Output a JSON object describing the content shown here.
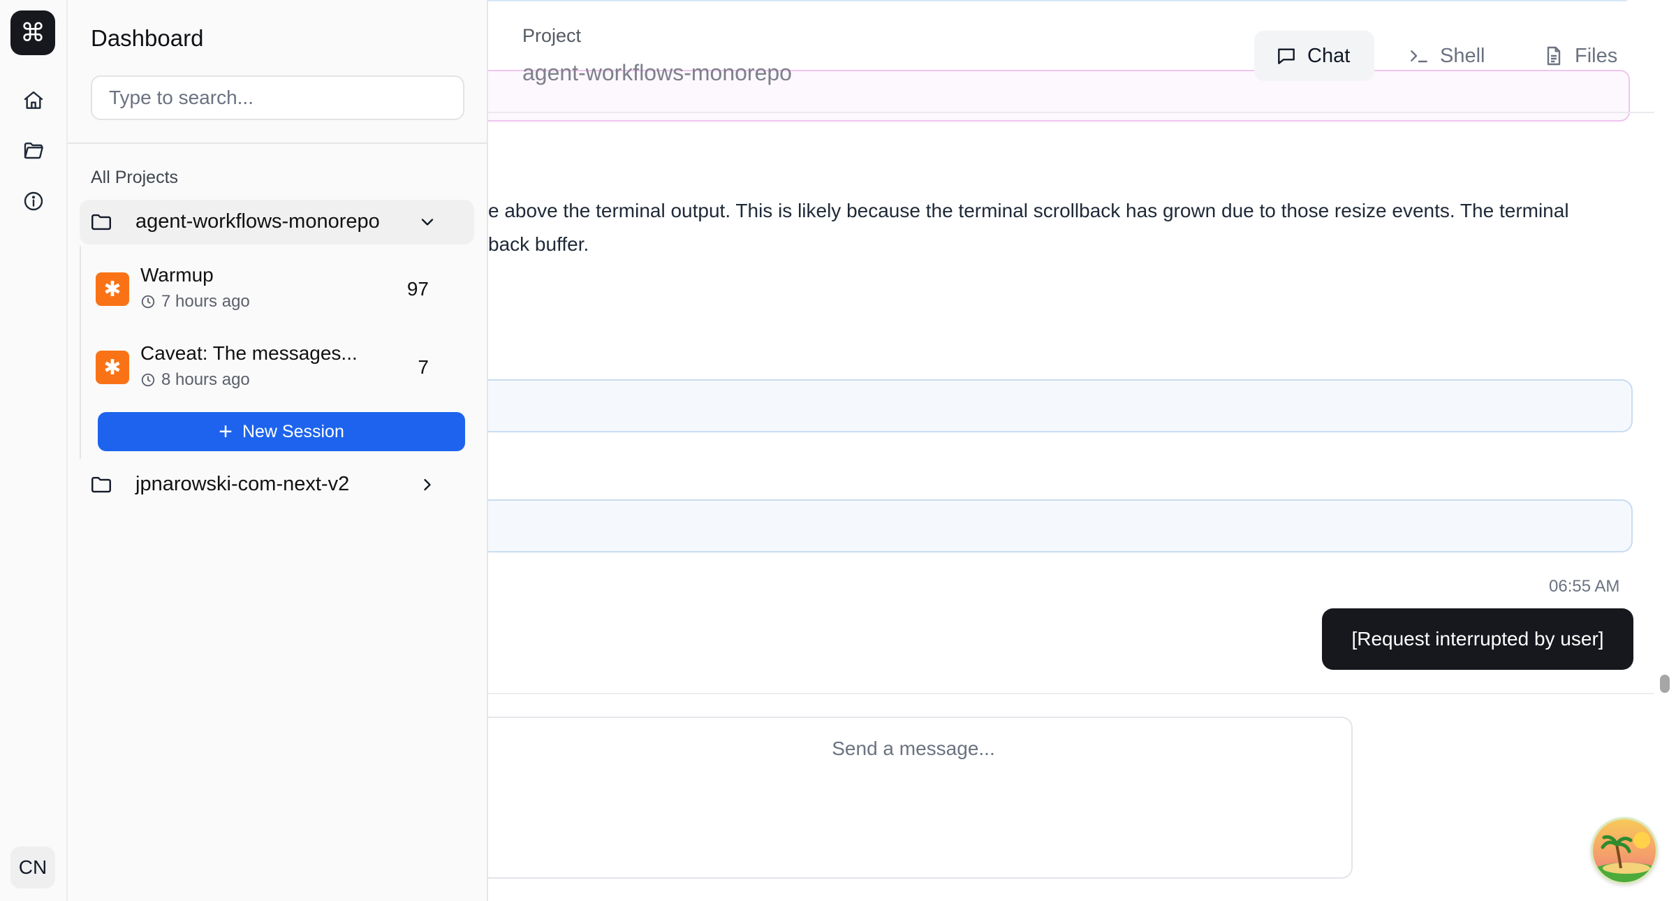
{
  "rail": {
    "logo_glyph": "⌘",
    "user_initials": "CN"
  },
  "sidebar": {
    "title": "Dashboard",
    "search_placeholder": "Type to search...",
    "section_label": "All Projects",
    "projects": [
      {
        "name": "agent-workflows-monorepo",
        "expanded": true,
        "sessions": [
          {
            "title": "Warmup",
            "time": "7 hours ago",
            "count": "97"
          },
          {
            "title": "Caveat: The messages...",
            "time": "8 hours ago",
            "count": "7"
          }
        ],
        "new_session_label": "New Session"
      },
      {
        "name": "jpnarowski-com-next-v2",
        "expanded": false
      }
    ]
  },
  "header": {
    "project_label": "Project",
    "project_name": "agent-workflows-monorepo",
    "tabs": [
      {
        "label": "Chat",
        "icon": "chat-bubble-icon",
        "active": true
      },
      {
        "label": "Shell",
        "icon": "terminal-prompt-icon",
        "active": false
      },
      {
        "label": "Files",
        "icon": "file-document-icon",
        "active": false
      }
    ]
  },
  "conversation": {
    "assistant_text_line1": "e above the terminal output. This is likely because the terminal scrollback has grown due to those resize events. The terminal",
    "assistant_text_line2": "back buffer.",
    "timestamp": "06:55 AM",
    "user_message": "[Request interrupted by user]"
  },
  "composer": {
    "placeholder": "Send a message..."
  },
  "colors": {
    "accent": "#1d63ed",
    "session_badge": "#f97316",
    "user_bubble": "#16181d"
  }
}
